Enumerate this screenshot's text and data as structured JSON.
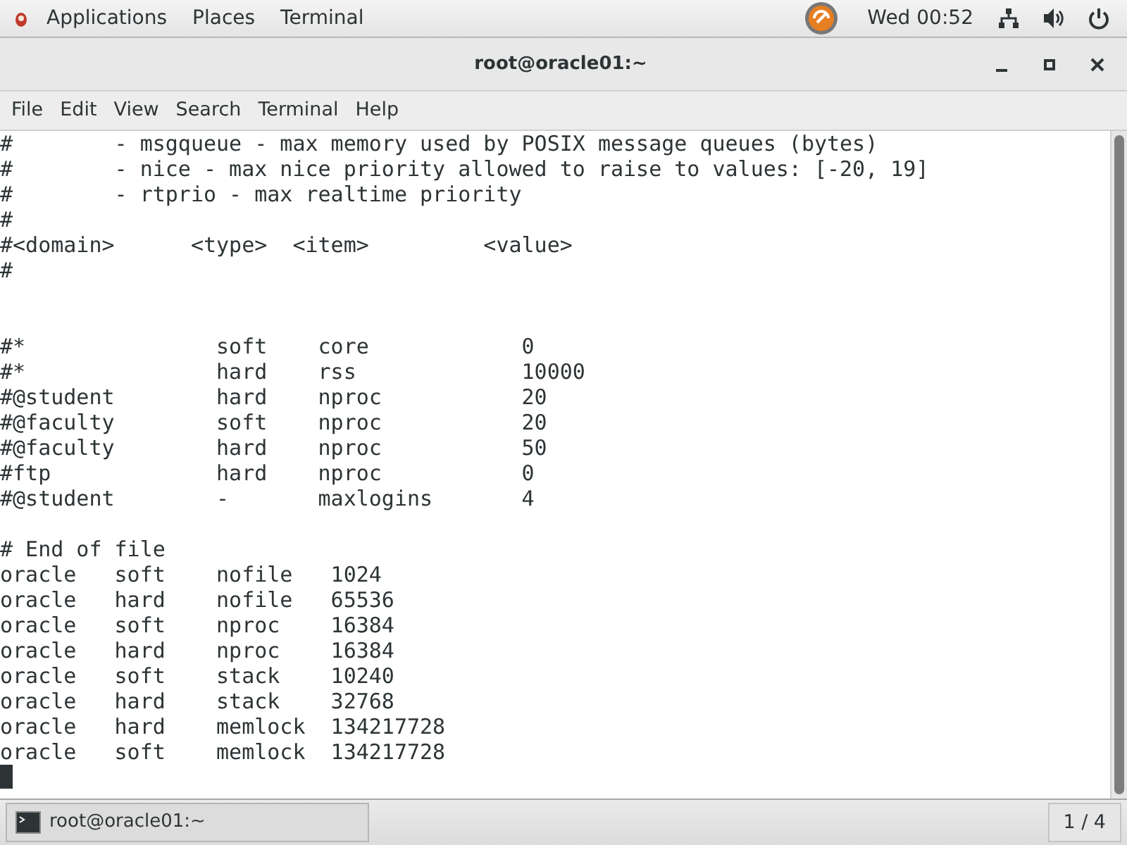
{
  "top_bar": {
    "menus": [
      "Applications",
      "Places",
      "Terminal"
    ],
    "clock": "Wed 00:52"
  },
  "window": {
    "title": "root@oracle01:~"
  },
  "menu_bar": [
    "File",
    "Edit",
    "View",
    "Search",
    "Terminal",
    "Help"
  ],
  "terminal": {
    "lines": [
      {
        "kind": "text",
        "text": "#        - msgqueue - max memory used by POSIX message queues (bytes)"
      },
      {
        "kind": "text",
        "text": "#        - nice - max nice priority allowed to raise to values: [-20, 19]"
      },
      {
        "kind": "text",
        "text": "#        - rtprio - max realtime priority"
      },
      {
        "kind": "text",
        "text": "#"
      },
      {
        "kind": "text",
        "text": "#<domain>      <type>  <item>         <value>"
      },
      {
        "kind": "text",
        "text": "#"
      },
      {
        "kind": "blank"
      },
      {
        "kind": "blank"
      },
      {
        "kind": "text",
        "text": "#*               soft    core            0"
      },
      {
        "kind": "text",
        "text": "#*               hard    rss             10000"
      },
      {
        "kind": "text",
        "text": "#@student        hard    nproc           20"
      },
      {
        "kind": "text",
        "text": "#@faculty        soft    nproc           20"
      },
      {
        "kind": "text",
        "text": "#@faculty        hard    nproc           50"
      },
      {
        "kind": "text",
        "text": "#ftp             hard    nproc           0"
      },
      {
        "kind": "text",
        "text": "#@student        -       maxlogins       4"
      },
      {
        "kind": "blank"
      },
      {
        "kind": "text",
        "text": "# End of file"
      },
      {
        "kind": "text",
        "text": "oracle   soft    nofile   1024"
      },
      {
        "kind": "text",
        "text": "oracle   hard    nofile   65536"
      },
      {
        "kind": "text",
        "text": "oracle   soft    nproc    16384"
      },
      {
        "kind": "text",
        "text": "oracle   hard    nproc    16384"
      },
      {
        "kind": "text",
        "text": "oracle   soft    stack    10240"
      },
      {
        "kind": "text",
        "text": "oracle   hard    stack    32768"
      },
      {
        "kind": "text",
        "text": "oracle   hard    memlock  134217728"
      },
      {
        "kind": "text",
        "text": "oracle   soft    memlock  134217728"
      },
      {
        "kind": "cursor"
      }
    ]
  },
  "taskbar": {
    "task": "root@oracle01:~",
    "workspace": "1 / 4"
  }
}
